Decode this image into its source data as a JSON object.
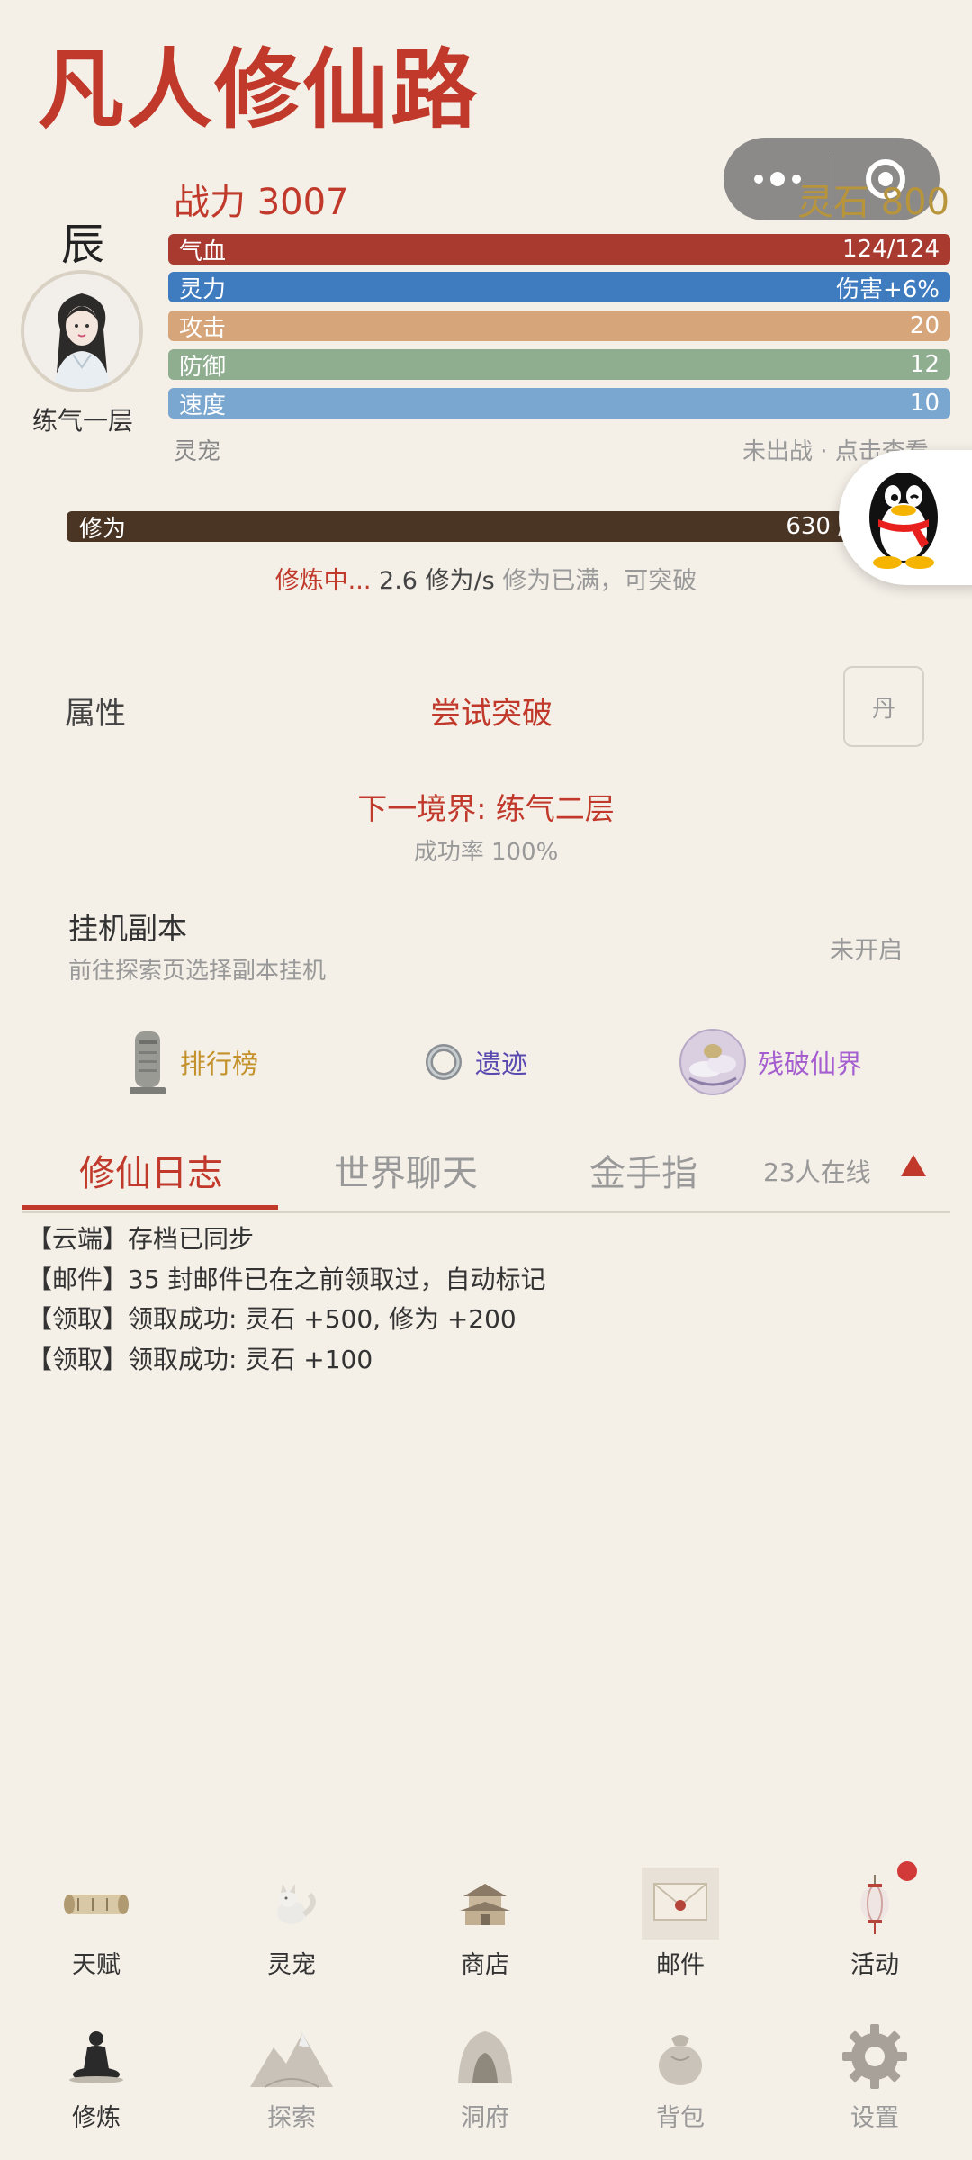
{
  "app": {
    "title": "凡人修仙路"
  },
  "character": {
    "name": "辰",
    "realm": "练气一层",
    "power_label": "战力 3007",
    "spirit_stone_label": "灵石 800"
  },
  "stats": {
    "hp": {
      "label": "气血",
      "value": "124/124"
    },
    "mp": {
      "label": "灵力",
      "value": "伤害+6%"
    },
    "atk": {
      "label": "攻击",
      "value": "20"
    },
    "def": {
      "label": "防御",
      "value": "12"
    },
    "spd": {
      "label": "速度",
      "value": "10"
    }
  },
  "pet": {
    "label": "灵宠",
    "status": "未出战 · 点击查看"
  },
  "cultivation": {
    "label": "修为",
    "value": "630 /",
    "status_active": "修炼中...",
    "rate": "2.6 修为/s",
    "note": "修为已满，可突破"
  },
  "attributes": {
    "label": "属性",
    "breakthrough": "尝试突破",
    "pill": "丹",
    "next_realm": "下一境界: 练气二层",
    "success_rate": "成功率 100%"
  },
  "idle": {
    "title": "挂机副本",
    "desc": "前往探索页选择副本挂机",
    "status": "未开启"
  },
  "shortcuts": {
    "rank": "排行榜",
    "ruins": "遗迹",
    "broken_realm": "残破仙界"
  },
  "tabs": {
    "log": "修仙日志",
    "chat": "世界聊天",
    "cheat": "金手指",
    "online": "23人在线"
  },
  "log": [
    "【云端】存档已同步",
    "【邮件】35 封邮件已在之前领取过，自动标记",
    "【领取】领取成功: 灵石 +500, 修为 +200",
    "【领取】领取成功: 灵石 +100"
  ],
  "nav_row1": {
    "talent": "天赋",
    "pet": "灵宠",
    "shop": "商店",
    "mail": "邮件",
    "events": "活动"
  },
  "nav_row2": {
    "cultivate": "修炼",
    "explore": "探索",
    "cave": "洞府",
    "bag": "背包",
    "settings": "设置"
  },
  "colors": {
    "accent": "#c0392b",
    "hp": "#a83a30",
    "mp": "#3f7bbf",
    "atk": "#d6a57a",
    "def": "#8fae90",
    "spd": "#7aa7d0",
    "cultivation": "#4a3524",
    "stone": "#b8953a"
  }
}
